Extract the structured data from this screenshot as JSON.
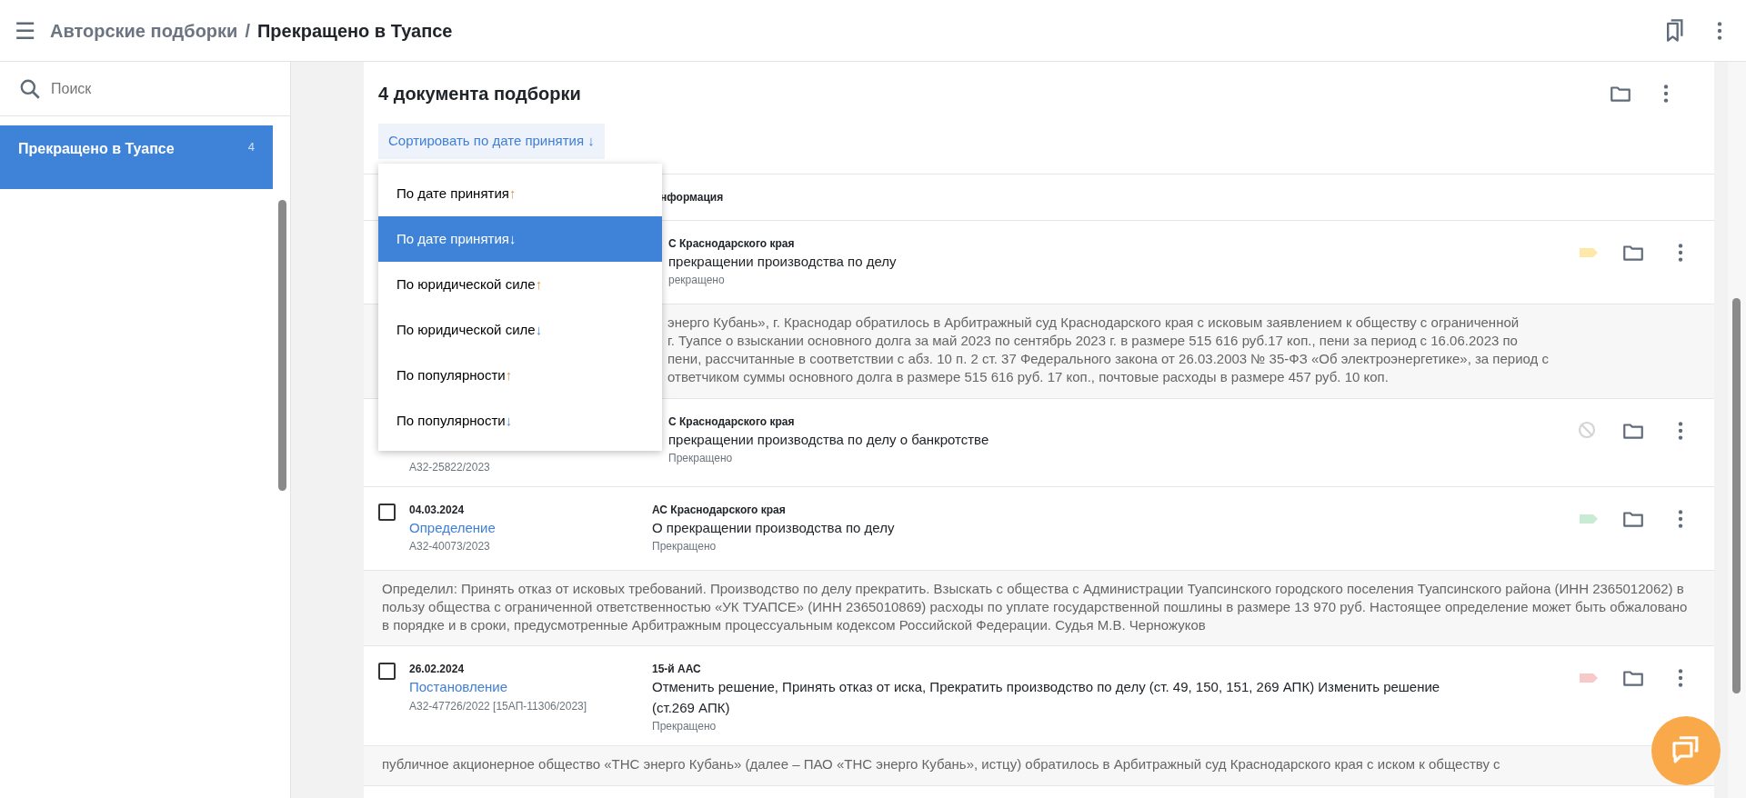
{
  "header": {
    "menu_glyph": "☰",
    "breadcrumb_parent": "Авторские подборки",
    "separator": "/",
    "title": "Прекращено в Туапсе"
  },
  "sidebar": {
    "search": {
      "placeholder": "Поиск"
    },
    "items": [
      {
        "label": "Прекращено в Туапсе",
        "count": "4",
        "selected": true
      }
    ]
  },
  "panel": {
    "title": "4 документа подборки",
    "sort_button": {
      "label": "Сортировать по дате принятия",
      "arrow": "↓"
    },
    "sort_menu": [
      {
        "label": "По дате принятия",
        "arrow": "↑",
        "selected": false
      },
      {
        "label": "По дате принятия",
        "arrow": "↓",
        "selected": true
      },
      {
        "label": "По юридической силе",
        "arrow": "↑",
        "selected": false
      },
      {
        "label": "По юридической силе",
        "arrow": "↓",
        "selected": false
      },
      {
        "label": "По популярности",
        "arrow": "↑",
        "selected": false
      },
      {
        "label": "По популярности",
        "arrow": "↓",
        "selected": false
      }
    ],
    "columns": [
      "нформация"
    ],
    "documents": [
      {
        "court": "С Краснодарского края",
        "title": "прекращении производства по делу",
        "status": "рекращено",
        "status_icon": {
          "kind": "tag",
          "color": "#ffe7a8"
        },
        "summary_lines": [
          "энерго Кубань», г. Краснодар обратилось в Арбитражный суд Краснодарского края с исковым заявлением к обществу с ограниченной",
          "г. Туапсе о взыскании основного долга за май 2023 по сентябрь 2023 г. в размере 515 616 руб.17 коп., пени за период с 16.06.2023 по",
          "пени, рассчитанные в соответствии с абз. 10 п. 2 ст. 37 Федерального закона от 26.03.2003 № 35-ФЗ «Об электроэнергетике», за период с",
          "ответчиком суммы основного долга в размере 515 616 руб. 17 коп., почтовые расходы в размере 457 руб. 10 коп."
        ]
      },
      {
        "number": "А32-25822/2023",
        "court": "С Краснодарского края",
        "title": "прекращении производства по делу о банкротстве",
        "status": "Прекращено",
        "status_icon": {
          "kind": "blocked"
        }
      },
      {
        "checked": false,
        "date": "04.03.2024",
        "type": "Определение",
        "number": "А32-40073/2023",
        "court": "АС Краснодарского края",
        "title": "О прекращении производства по делу",
        "status": "Прекращено",
        "status_icon": {
          "kind": "tag",
          "color": "#c9ead3"
        },
        "summary": "Определил: Принять отказ от исковых требований. Производство по делу прекратить. Взыскать с общества с Администрации Туапсинского городского поселения Туапсинского района (ИНН 2365012062) в пользу общества с ограниченной ответственностью «УК ТУАПСЕ» (ИНН 2365010869) расходы по уплате государственной пошлины в размере 13 970 руб. Настоящее определение может быть обжаловано в порядке и в сроки, предусмотренные Арбитражным процессуальным кодексом Российской Федерации. Судья М.В. Черножуков"
      },
      {
        "checked": false,
        "date": "26.02.2024",
        "type": "Постановление",
        "number": "А32-47726/2022 [15АП-11306/2023]",
        "court": "15-й ААС",
        "title": "Отменить решение, Принять отказ от иска, Прекратить производство по делу (ст. 49, 150, 151, 269 АПК) Изменить решение (ст.269 АПК)",
        "status": "Прекращено",
        "status_icon": {
          "kind": "tag",
          "color": "#f8c9c9"
        },
        "summary": "публичное акционерное общество «ТНС энерго Кубань» (далее – ПАО «ТНС энерго Кубань», истцу) обратилось в Арбитражный суд Краснодарского края с иском к обществу с"
      }
    ]
  }
}
